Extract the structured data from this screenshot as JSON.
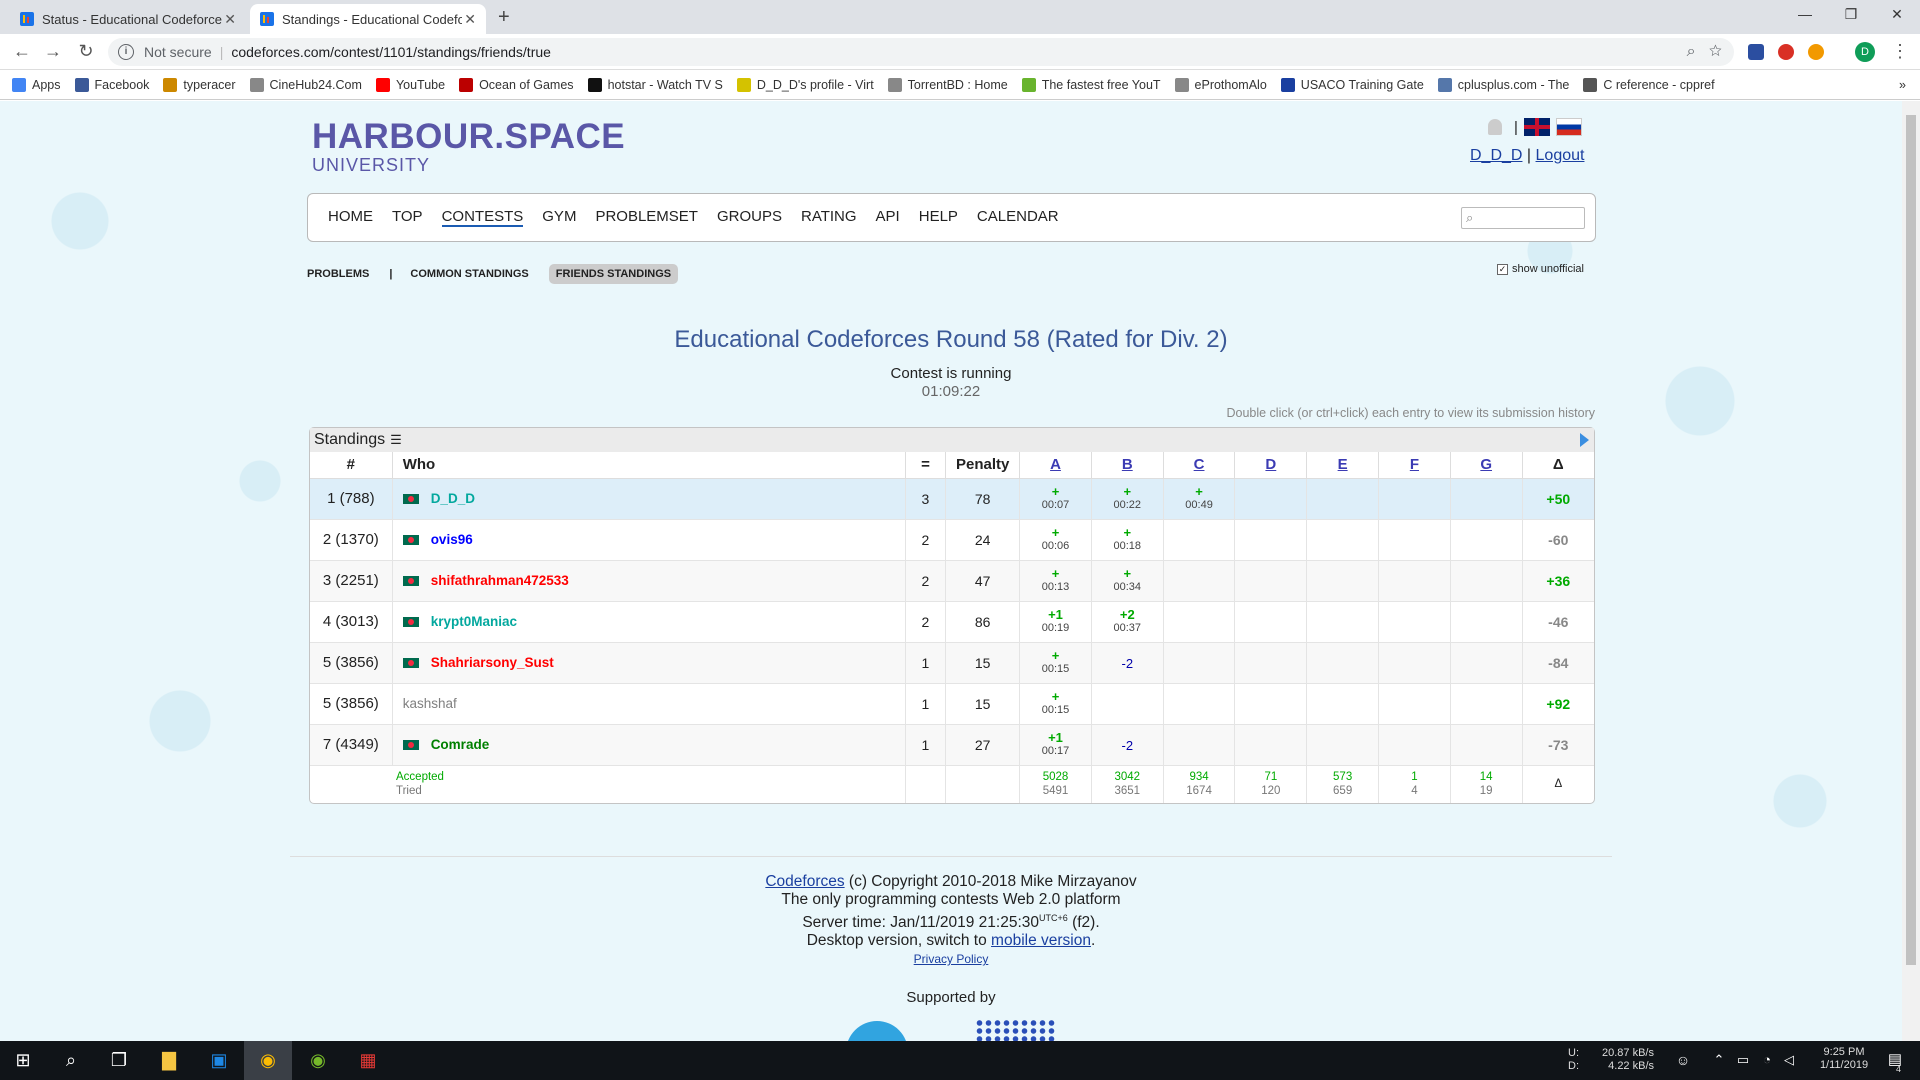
{
  "browser": {
    "tabs": [
      {
        "title": "Status - Educational Codeforces R"
      },
      {
        "title": "Standings - Educational Codeforc"
      }
    ],
    "new_tab": "+",
    "window_controls": [
      "—",
      "❐",
      "✕"
    ],
    "address": {
      "security": "Not secure",
      "url": "codeforces.com/contest/1101/standings/friends/true"
    },
    "bookmarks": [
      "Apps",
      "Facebook",
      "typeracer",
      "CineHub24.Com",
      "YouTube",
      "Ocean of Games",
      "hotstar - Watch TV S",
      "D_D_D's profile - Virt",
      "TorrentBD : Home",
      "The fastest free YouT",
      "eProthomAlo",
      "USACO Training Gate",
      "cplusplus.com - The",
      "C reference - cppref"
    ],
    "bookmark_colors": [
      "#4285f4",
      "#3b5998",
      "#cc8800",
      "#888",
      "#ff0000",
      "#bb0000",
      "#111",
      "#d4c200",
      "#888",
      "#69b42e",
      "#888",
      "#1a3fa0",
      "#5577aa",
      "#555"
    ],
    "avatar": "D"
  },
  "header": {
    "logo_line1": "HARBOUR.SPACE",
    "logo_line2": "UNIVERSITY",
    "separator": "|",
    "user": "D_D_D",
    "logout": "Logout"
  },
  "menu": [
    "HOME",
    "TOP",
    "CONTESTS",
    "GYM",
    "PROBLEMSET",
    "GROUPS",
    "RATING",
    "API",
    "HELP",
    "CALENDAR"
  ],
  "menu_selected": "CONTESTS",
  "subnav": {
    "problems": "PROBLEMS",
    "bar": "|",
    "common": "COMMON STANDINGS",
    "friends": "FRIENDS STANDINGS"
  },
  "show_unofficial": {
    "label": "show unofficial",
    "checked": true
  },
  "contest": {
    "title": "Educational Codeforces Round 58 (Rated for Div. 2)",
    "status": "Contest is running",
    "timer": "01:09:22",
    "hint": "Double click (or ctrl+click) each entry to view its submission history"
  },
  "standings": {
    "caption": "Standings",
    "headers": {
      "rank": "#",
      "who": "Who",
      "solved": "=",
      "penalty": "Penalty",
      "delta": "Δ"
    },
    "problems": [
      "A",
      "B",
      "C",
      "D",
      "E",
      "F",
      "G"
    ],
    "rows": [
      {
        "rank": "1 (788)",
        "who": "D_D_D",
        "color": "#03a89e",
        "flag": true,
        "solved": "3",
        "penalty": "78",
        "cells": [
          {
            "top": "+",
            "time": "00:07"
          },
          {
            "top": "+",
            "time": "00:22"
          },
          {
            "top": "+",
            "time": "00:49"
          },
          null,
          null,
          null,
          null
        ],
        "delta": "+50",
        "delta_pos": true
      },
      {
        "rank": "2 (1370)",
        "who": "ovis96",
        "color": "#0000ff",
        "flag": true,
        "solved": "2",
        "penalty": "24",
        "cells": [
          {
            "top": "+",
            "time": "00:06"
          },
          {
            "top": "+",
            "time": "00:18"
          },
          null,
          null,
          null,
          null,
          null
        ],
        "delta": "-60",
        "delta_pos": false
      },
      {
        "rank": "3 (2251)",
        "who": "shifathrahman472533",
        "color": "#ff0000",
        "flag": true,
        "solved": "2",
        "penalty": "47",
        "cells": [
          {
            "top": "+",
            "time": "00:13"
          },
          {
            "top": "+",
            "time": "00:34"
          },
          null,
          null,
          null,
          null,
          null
        ],
        "delta": "+36",
        "delta_pos": true
      },
      {
        "rank": "4 (3013)",
        "who": "krypt0Maniac",
        "color": "#03a89e",
        "flag": true,
        "solved": "2",
        "penalty": "86",
        "cells": [
          {
            "top": "+1",
            "time": "00:19"
          },
          {
            "top": "+2",
            "time": "00:37"
          },
          null,
          null,
          null,
          null,
          null
        ],
        "delta": "-46",
        "delta_pos": false
      },
      {
        "rank": "5 (3856)",
        "who": "Shahriarsony_Sust",
        "color": "#ff0000",
        "flag": true,
        "solved": "1",
        "penalty": "15",
        "cells": [
          {
            "top": "+",
            "time": "00:15"
          },
          {
            "neg": "-2"
          },
          null,
          null,
          null,
          null,
          null
        ],
        "delta": "-84",
        "delta_pos": false
      },
      {
        "rank": "5 (3856)",
        "who": "kashshaf",
        "color": "#808080",
        "flag": false,
        "solved": "1",
        "penalty": "15",
        "cells": [
          {
            "top": "+",
            "time": "00:15"
          },
          null,
          null,
          null,
          null,
          null,
          null
        ],
        "delta": "+92",
        "delta_pos": true
      },
      {
        "rank": "7 (4349)",
        "who": "Comrade",
        "color": "#008000",
        "flag": true,
        "solved": "1",
        "penalty": "27",
        "cells": [
          {
            "top": "+1",
            "time": "00:17"
          },
          {
            "neg": "-2"
          },
          null,
          null,
          null,
          null,
          null
        ],
        "delta": "-73",
        "delta_pos": false
      }
    ],
    "footer": {
      "accepted_label": "Accepted",
      "tried_label": "Tried",
      "accepted": [
        "5028",
        "3042",
        "934",
        "71",
        "573",
        "1",
        "14"
      ],
      "tried": [
        "5491",
        "3651",
        "1674",
        "120",
        "659",
        "4",
        "19"
      ],
      "delta": "Δ"
    }
  },
  "footer": {
    "codeforces": "Codeforces",
    "copyright": " (c) Copyright 2010-2018 Mike Mirzayanov",
    "tagline": "The only programming contests Web 2.0 platform",
    "server_time_prefix": "Server time: Jan/11/2019 21:25:30",
    "utc": "UTC+6",
    "server_time_suffix": " (f2).",
    "desktop_prefix": "Desktop version, switch to ",
    "mobile": "mobile version",
    "desktop_suffix": ".",
    "privacy": "Privacy Policy",
    "supported": "Supported by"
  },
  "taskbar": {
    "net_labels": [
      "U:",
      "D:"
    ],
    "net_up": "20.87 kB/s",
    "net_down": "4.22 kB/s",
    "time": "9:25 PM",
    "date": "1/11/2019",
    "notifications": "4"
  }
}
